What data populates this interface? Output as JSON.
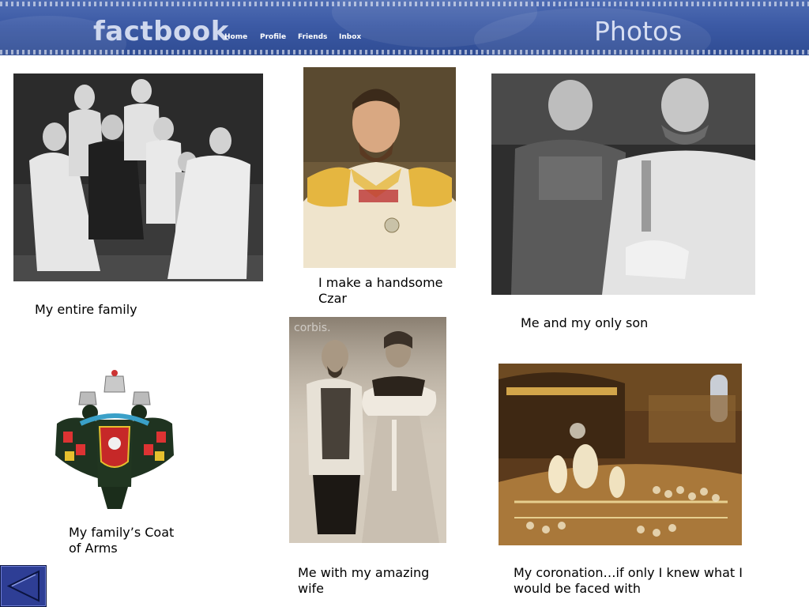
{
  "header": {
    "logo": "factbook",
    "nav": [
      "Home",
      "Profile",
      "Friends",
      "Inbox"
    ],
    "title": "Photos"
  },
  "photos": [
    {
      "caption": "My entire family"
    },
    {
      "caption": "I make a handsome\nCzar"
    },
    {
      "caption": "Me and my only son"
    },
    {
      "caption": "My family’s Coat\nof Arms"
    },
    {
      "caption": "Me with my amazing\nwife",
      "watermark": "corbis."
    },
    {
      "caption": "My coronation…if only I knew what I\nwould be faced with"
    }
  ],
  "controls": {
    "back_icon": "triangle-left-icon"
  }
}
